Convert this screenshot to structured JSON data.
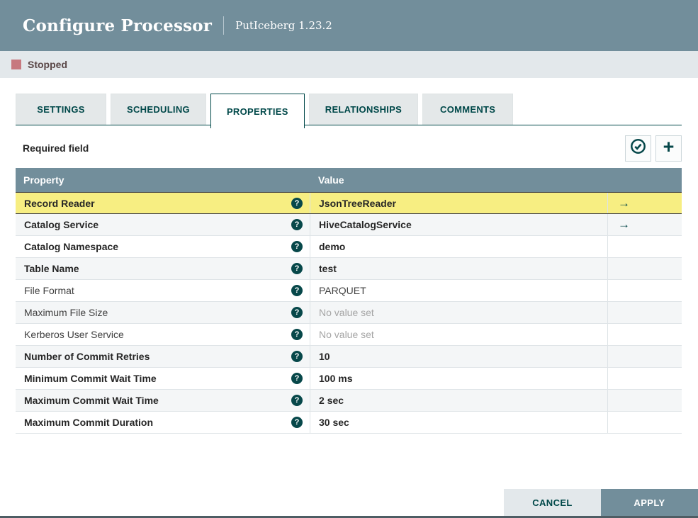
{
  "dialog": {
    "title": "Configure Processor",
    "subtitle": "PutIceberg 1.23.2"
  },
  "status": {
    "label": "Stopped"
  },
  "tabs": [
    {
      "label": "SETTINGS",
      "active": false
    },
    {
      "label": "SCHEDULING",
      "active": false
    },
    {
      "label": "PROPERTIES",
      "active": true
    },
    {
      "label": "RELATIONSHIPS",
      "active": false
    },
    {
      "label": "COMMENTS",
      "active": false
    }
  ],
  "toolbar": {
    "required_label": "Required field",
    "verify_icon": "check-circle-icon",
    "add_icon": "plus-icon",
    "help_icon": "question-circle-icon",
    "goto_icon": "arrow-right-icon",
    "plus_glyph": "+",
    "arrow_glyph": "→",
    "help_glyph": "?"
  },
  "table": {
    "columns": {
      "property": "Property",
      "value": "Value"
    },
    "rows": [
      {
        "property": "Record Reader",
        "value": "JsonTreeReader",
        "required": true,
        "selected": true,
        "placeholder": false,
        "has_link": true
      },
      {
        "property": "Catalog Service",
        "value": "HiveCatalogService",
        "required": true,
        "selected": false,
        "placeholder": false,
        "has_link": true
      },
      {
        "property": "Catalog Namespace",
        "value": "demo",
        "required": true,
        "selected": false,
        "placeholder": false,
        "has_link": false
      },
      {
        "property": "Table Name",
        "value": "test",
        "required": true,
        "selected": false,
        "placeholder": false,
        "has_link": false
      },
      {
        "property": "File Format",
        "value": "PARQUET",
        "required": false,
        "selected": false,
        "placeholder": false,
        "has_link": false
      },
      {
        "property": "Maximum File Size",
        "value": "No value set",
        "required": false,
        "selected": false,
        "placeholder": true,
        "has_link": false
      },
      {
        "property": "Kerberos User Service",
        "value": "No value set",
        "required": false,
        "selected": false,
        "placeholder": true,
        "has_link": false
      },
      {
        "property": "Number of Commit Retries",
        "value": "10",
        "required": true,
        "selected": false,
        "placeholder": false,
        "has_link": false
      },
      {
        "property": "Minimum Commit Wait Time",
        "value": "100 ms",
        "required": true,
        "selected": false,
        "placeholder": false,
        "has_link": false
      },
      {
        "property": "Maximum Commit Wait Time",
        "value": "2 sec",
        "required": true,
        "selected": false,
        "placeholder": false,
        "has_link": false
      },
      {
        "property": "Maximum Commit Duration",
        "value": "30 sec",
        "required": true,
        "selected": false,
        "placeholder": false,
        "has_link": false
      }
    ]
  },
  "footer": {
    "cancel_label": "CANCEL",
    "apply_label": "APPLY"
  },
  "colors": {
    "header_bg": "#728e9b",
    "accent_teal": "#004849",
    "status_bar_bg": "#e3e8eb",
    "stopped_red": "#c7797f",
    "selected_row_yellow": "#f7ee82",
    "alt_row": "#f4f6f7"
  }
}
